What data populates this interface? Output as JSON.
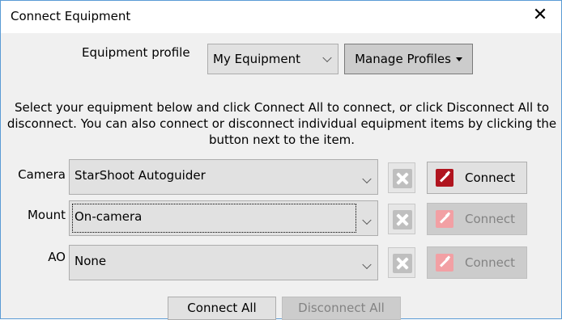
{
  "window": {
    "title": "Connect Equipment",
    "close_glyph": "✕"
  },
  "profile": {
    "label": "Equipment profile",
    "selected": "My Equipment",
    "manage_label": "Manage Profiles"
  },
  "instructions": "Select your equipment below and click Connect All to connect, or click Disconnect All to disconnect. You can also connect or disconnect individual equipment items by clicking the button next to the item.",
  "devices": [
    {
      "label": "Camera",
      "value": "StarShoot Autoguider",
      "connect_label": "Connect",
      "connect_enabled": true
    },
    {
      "label": "Mount",
      "value": "On-camera",
      "connect_label": "Connect",
      "connect_enabled": false
    },
    {
      "label": "AO",
      "value": "None",
      "connect_label": "Connect",
      "connect_enabled": false
    }
  ],
  "footer": {
    "connect_all": "Connect All",
    "disconnect_all": "Disconnect All"
  },
  "colors": {
    "window_border": "#5a9bd5",
    "plug_red": "#b0141e",
    "plug_red_disabled": "#f2a0a4"
  }
}
